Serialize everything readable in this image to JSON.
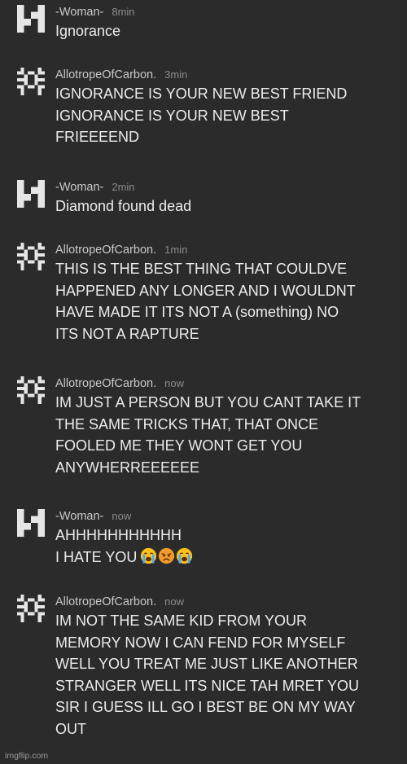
{
  "messages": [
    {
      "avatar": "woman-avatar-icon",
      "user": "-Woman-",
      "time": "8min",
      "lines": [
        "Ignorance"
      ]
    },
    {
      "avatar": "carbon-avatar-icon",
      "user": "AllotropeOfCarbon.",
      "time": "3min",
      "lines": [
        "IGNORANCE IS YOUR NEW BEST FRIEND",
        "IGNORANCE IS YOUR NEW BEST",
        "FRIEEEEND"
      ]
    },
    {
      "avatar": "woman-avatar-icon",
      "user": "-Woman-",
      "time": "2min",
      "lines": [
        "Diamond found dead"
      ]
    },
    {
      "avatar": "carbon-avatar-icon",
      "user": "AllotropeOfCarbon.",
      "time": "1min",
      "lines": [
        "THIS IS THE BEST THING THAT COULDVE",
        "HAPPENED ANY LONGER AND I WOULDNT",
        "HAVE MADE IT ITS NOT A (something) NO",
        "ITS NOT A RAPTURE"
      ]
    },
    {
      "avatar": "carbon-avatar-icon",
      "user": "AllotropeOfCarbon.",
      "time": "now",
      "lines": [
        "IM JUST A PERSON BUT YOU CANT TAKE IT",
        "THE SAME TRICKS THAT, THAT ONCE",
        "FOOLED ME THEY WONT GET YOU",
        "ANYWHERREEEEEE"
      ]
    },
    {
      "avatar": "woman-avatar-icon",
      "user": "-Woman-",
      "time": "now",
      "lines": [
        "AHHHHHHHHHHH",
        "I HATE YOU"
      ],
      "emojis": [
        "loudly-crying-face-icon",
        "angry-face-icon",
        "loudly-crying-face-icon"
      ]
    },
    {
      "avatar": "carbon-avatar-icon",
      "user": "AllotropeOfCarbon.",
      "time": "now",
      "lines": [
        "IM NOT THE SAME KID FROM YOUR",
        "MEMORY NOW I CAN FEND FOR MYSELF",
        "WELL YOU TREAT ME JUST LIKE ANOTHER",
        "STRANGER WELL ITS NICE TAH MRET YOU",
        "SIR I GUESS ILL GO I BEST BE ON MY WAY",
        "OUT"
      ]
    }
  ],
  "watermark": "imgflip.com",
  "colors": {
    "background": "#2b2b2c",
    "avatar": "#e6e6e6",
    "text": "#ececec",
    "username": "#c9c9c9",
    "timestamp": "#8c8c8c"
  }
}
